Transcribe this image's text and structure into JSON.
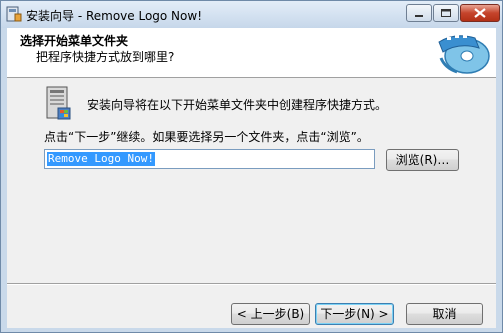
{
  "window": {
    "title": "安装向导 - Remove Logo Now!"
  },
  "header": {
    "title": "选择开始菜单文件夹",
    "subtitle": "把程序快捷方式放到哪里?"
  },
  "body": {
    "intro": "安装向导将在以下开始菜单文件夹中创建程序快捷方式。",
    "hint": "点击“下一步”继续。如果要选择另一个文件夹，点击“浏览”。"
  },
  "folder_input": {
    "value": "Remove Logo Now!"
  },
  "buttons": {
    "browse": "浏览(R)…",
    "back": "< 上一步(B)",
    "next": "下一步(N) >",
    "cancel": "取消"
  },
  "icons": {
    "app": "setup-app-icon",
    "minimize": "minimize-icon",
    "maximize": "maximize-icon",
    "close": "close-icon",
    "header_logo": "film-cd-logo-icon",
    "folder": "start-menu-folder-icon"
  }
}
